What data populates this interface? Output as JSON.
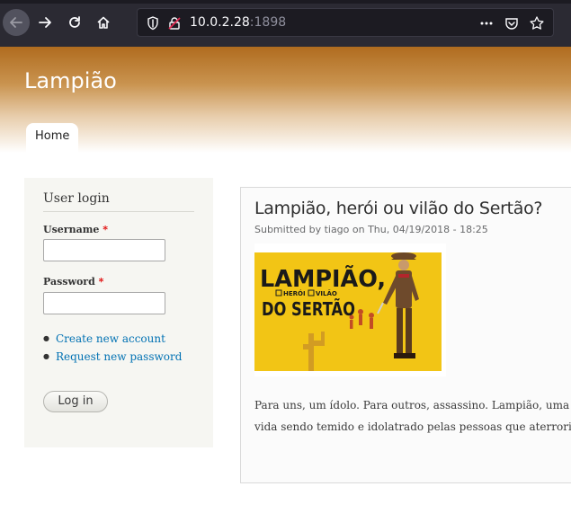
{
  "browser": {
    "url_host": "10.0.2.28",
    "url_port": ":1898"
  },
  "site": {
    "name": "Lampião",
    "tabs": [
      {
        "label": "Home"
      }
    ]
  },
  "login": {
    "title": "User login",
    "username_label": "Username",
    "password_label": "Password",
    "required_marker": "*",
    "username_value": "",
    "password_value": "",
    "links": [
      {
        "label": "Create new account"
      },
      {
        "label": "Request new password"
      }
    ],
    "submit_label": "Log in"
  },
  "article": {
    "title": "Lampião, herói ou vilão do Sertão?",
    "submitted": "Submitted by tiago on Thu, 04/19/2018 - 18:25",
    "image": {
      "line1": "LAMPIÃO,",
      "tag1": "HERÓI",
      "tag2": "VILÃO",
      "line2": "DO SERTÃO",
      "colors": {
        "yellow": "#f2c515",
        "ink": "#1a1a1a",
        "red": "#b3262b"
      }
    },
    "body_lines": [
      "Para uns, um ídolo. Para outros, assassino. Lampião, uma das f",
      "vida sendo temido e idolatrado pelas pessoas que aterrorizava e"
    ]
  },
  "colors": {
    "header_top": "#b06c1f",
    "link": "#0071b3",
    "required": "#e00000",
    "chrome": "#2b2a33"
  }
}
